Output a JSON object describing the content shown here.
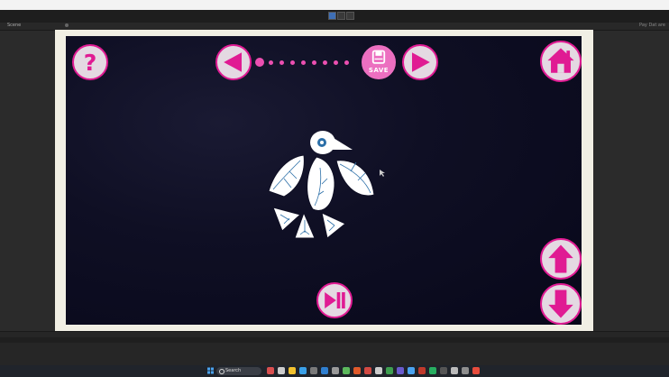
{
  "editor": {
    "scene_tab": "Scene",
    "right_tab": "Pay Dat are",
    "taskbar_search_placeholder": "Search"
  },
  "game": {
    "save_label": "SAVE",
    "colors": {
      "accent": "#e01b93",
      "button_fill": "#e4d9e2",
      "progress_dot": "#ec4fb1",
      "frame": "#f1efe4",
      "background": "#0f0f24"
    },
    "progress": {
      "total_steps": 9,
      "current_step": 1
    },
    "icons": {
      "help": "question-mark-icon",
      "previous": "arrow-left-icon",
      "save": "floppy-save-icon",
      "next": "arrow-right-icon",
      "home": "home-icon",
      "play_pause": "play-pause-icon",
      "up": "arrow-up-icon",
      "down": "arrow-down-icon",
      "figure": "bird-tangram-figure"
    }
  }
}
